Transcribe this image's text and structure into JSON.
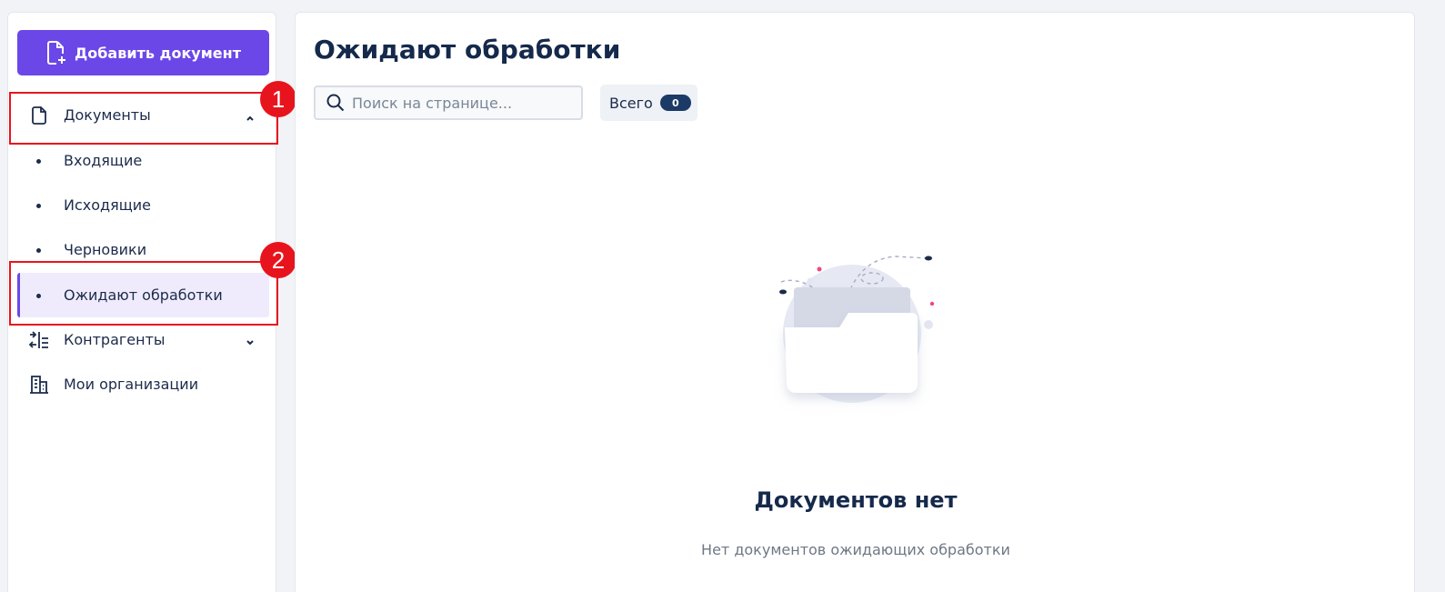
{
  "sidebar": {
    "add_button_label": "Добавить документ",
    "documents_label": "Документы",
    "sub_items": [
      {
        "label": "Входящие"
      },
      {
        "label": "Исходящие"
      },
      {
        "label": "Черновики"
      },
      {
        "label": "Ожидают обработки"
      }
    ],
    "contractors_label": "Контрагенты",
    "organizations_label": "Мои организации"
  },
  "annotations": [
    {
      "number": "1"
    },
    {
      "number": "2"
    }
  ],
  "main": {
    "title": "Ожидают обработки",
    "search_placeholder": "Поиск на странице...",
    "total_label": "Всего",
    "total_count": "0",
    "empty_title": "Документов нет",
    "empty_subtitle": "Нет документов ожидающих обработки"
  },
  "colors": {
    "accent": "#6b47e8",
    "annotation": "#e8141d",
    "text": "#1c2b4a"
  }
}
